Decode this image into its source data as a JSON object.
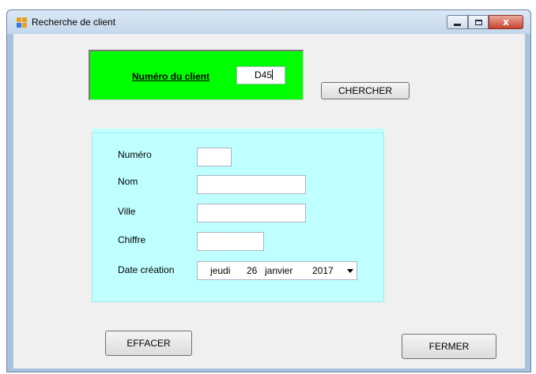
{
  "window": {
    "title": "Recherche de client",
    "controls": {
      "minimize": "minimize",
      "maximize": "maximize",
      "close": "x"
    }
  },
  "search": {
    "label": "Numéro du client",
    "value": "D45",
    "button": "CHERCHER"
  },
  "form": {
    "numero_label": "Numéro",
    "nom_label": "Nom",
    "ville_label": "Ville",
    "chiffre_label": "Chiffre",
    "date_label": "Date création",
    "numero_value": "",
    "nom_value": "",
    "ville_value": "",
    "chiffre_value": "",
    "date": {
      "weekday": "jeudi",
      "day": "26",
      "month": "janvier",
      "year": "2017"
    }
  },
  "actions": {
    "clear": "EFFACER",
    "close": "FERMER"
  },
  "colors": {
    "search_panel": "#00ff00",
    "form_panel": "#c0ffff",
    "client_area": "#f0f0f0"
  },
  "icons": {
    "app": "app-window-icon",
    "minimize": "minimize-icon",
    "maximize": "maximize-icon",
    "close": "close-icon",
    "dropdown": "chevron-down-icon"
  }
}
